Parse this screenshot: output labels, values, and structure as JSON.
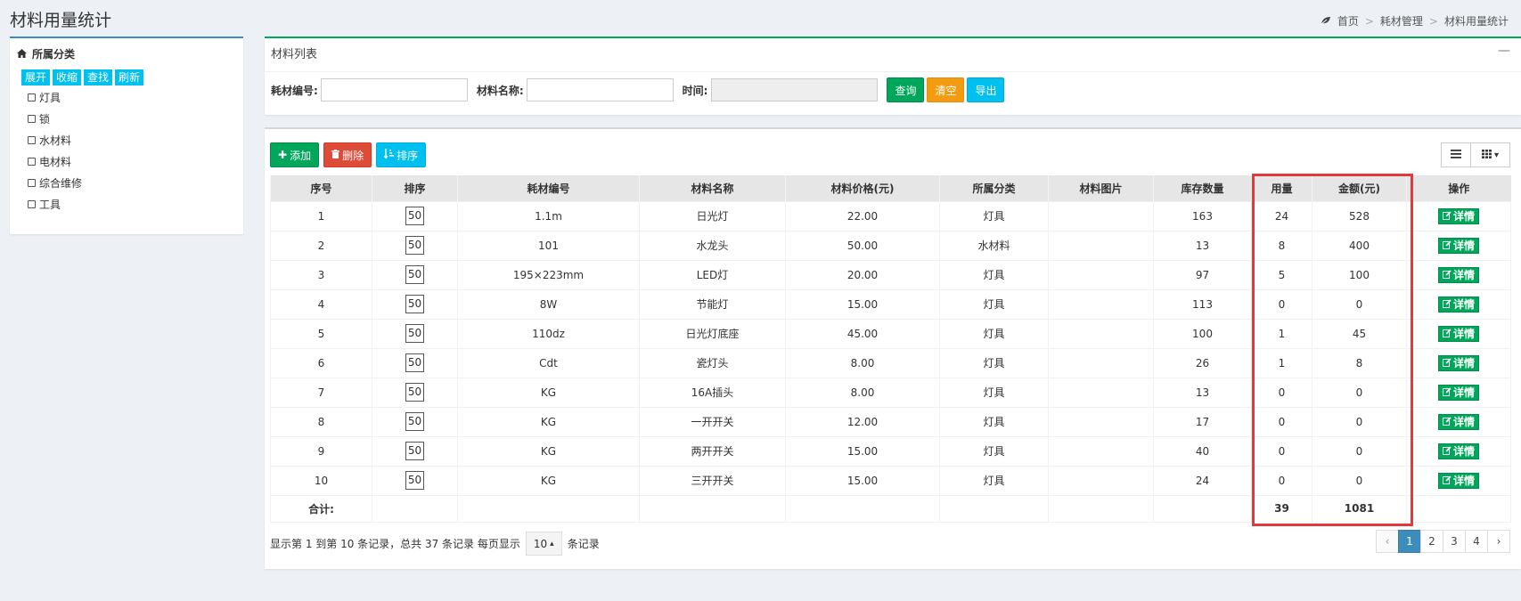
{
  "page": {
    "title": "材料用量统计",
    "breadcrumb": [
      "首页",
      "耗材管理",
      "材料用量统计"
    ]
  },
  "sidebar": {
    "title": "所属分类",
    "buttons": [
      "展开",
      "收缩",
      "查找",
      "刷新"
    ],
    "items": [
      "灯具",
      "锁",
      "水材料",
      "电材料",
      "综合维修",
      "工具"
    ]
  },
  "search": {
    "panel_title": "材料列表",
    "code_label": "耗材编号:",
    "code_value": "",
    "name_label": "材料名称:",
    "name_value": "",
    "time_label": "时间:",
    "time_value": "",
    "query_label": "查询",
    "clear_label": "清空",
    "export_label": "导出"
  },
  "toolbar": {
    "add_label": "添加",
    "delete_label": "删除",
    "sort_label": "排序"
  },
  "table": {
    "headers": [
      "序号",
      "排序",
      "耗材编号",
      "材料名称",
      "材料价格(元)",
      "所属分类",
      "材料图片",
      "库存数量",
      "用量",
      "金额(元)",
      "操作"
    ],
    "detail_label": "详情",
    "rows": [
      {
        "no": "1",
        "sort": "50",
        "code": "1.1m",
        "name": "日光灯",
        "price": "22.00",
        "category": "灯具",
        "image": "",
        "stock": "163",
        "usage": "24",
        "amount": "528"
      },
      {
        "no": "2",
        "sort": "50",
        "code": "101",
        "name": "水龙头",
        "price": "50.00",
        "category": "水材料",
        "image": "",
        "stock": "13",
        "usage": "8",
        "amount": "400"
      },
      {
        "no": "3",
        "sort": "50",
        "code": "195×223mm",
        "name": "LED灯",
        "price": "20.00",
        "category": "灯具",
        "image": "",
        "stock": "97",
        "usage": "5",
        "amount": "100"
      },
      {
        "no": "4",
        "sort": "50",
        "code": "8W",
        "name": "节能灯",
        "price": "15.00",
        "category": "灯具",
        "image": "",
        "stock": "113",
        "usage": "0",
        "amount": "0"
      },
      {
        "no": "5",
        "sort": "50",
        "code": "110dz",
        "name": "日光灯底座",
        "price": "45.00",
        "category": "灯具",
        "image": "",
        "stock": "100",
        "usage": "1",
        "amount": "45"
      },
      {
        "no": "6",
        "sort": "50",
        "code": "Cdt",
        "name": "瓷灯头",
        "price": "8.00",
        "category": "灯具",
        "image": "",
        "stock": "26",
        "usage": "1",
        "amount": "8"
      },
      {
        "no": "7",
        "sort": "50",
        "code": "KG",
        "name": "16A插头",
        "price": "8.00",
        "category": "灯具",
        "image": "",
        "stock": "13",
        "usage": "0",
        "amount": "0"
      },
      {
        "no": "8",
        "sort": "50",
        "code": "KG",
        "name": "一开开关",
        "price": "12.00",
        "category": "灯具",
        "image": "",
        "stock": "17",
        "usage": "0",
        "amount": "0"
      },
      {
        "no": "9",
        "sort": "50",
        "code": "KG",
        "name": "两开开关",
        "price": "15.00",
        "category": "灯具",
        "image": "",
        "stock": "40",
        "usage": "0",
        "amount": "0"
      },
      {
        "no": "10",
        "sort": "50",
        "code": "KG",
        "name": "三开开关",
        "price": "15.00",
        "category": "灯具",
        "image": "",
        "stock": "24",
        "usage": "0",
        "amount": "0"
      }
    ],
    "total": {
      "label": "合计:",
      "usage": "39",
      "amount": "1081"
    }
  },
  "footer": {
    "info_prefix": "显示第 1 到第 10 条记录，总共 37 条记录  每页显示",
    "page_size": "10",
    "info_suffix": "条记录",
    "pages": [
      "‹",
      "1",
      "2",
      "3",
      "4",
      "›"
    ],
    "current_page": "1"
  },
  "colors": {
    "accent_blue": "#3c8dbc",
    "green": "#00a65a",
    "orange": "#f39c12",
    "cyan": "#00c0ef",
    "red": "#dd4b39",
    "highlight": "#e4393c"
  }
}
